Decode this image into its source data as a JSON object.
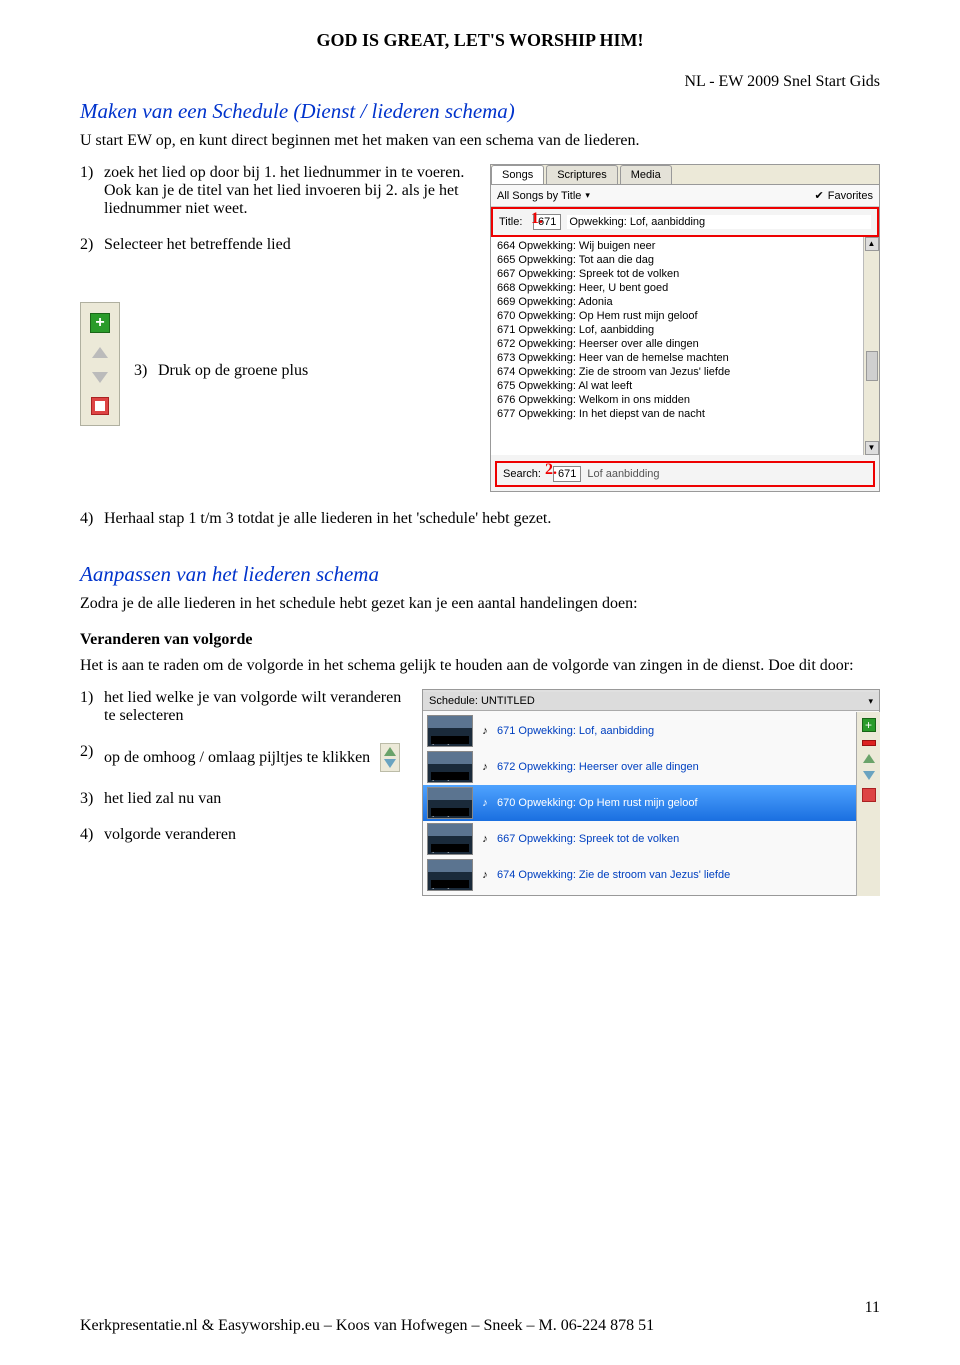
{
  "header": {
    "title": "GOD IS GREAT, LET'S WORSHIP HIM!",
    "subtitle_right": "NL - EW 2009  Snel Start Gids"
  },
  "section1": {
    "title": "Maken van een Schedule (Dienst / liederen schema)",
    "intro": "U start EW op, en kunt direct beginnen met het maken van een schema van de liederen.",
    "steps": {
      "s1_num": "1)",
      "s1": "zoek het lied op door bij 1. het liednummer in te voeren. Ook kan je de titel van het lied invoeren bij 2. als je het liednummer niet weet.",
      "s2_num": "2)",
      "s2": "Selecteer het betreffende lied",
      "s3_num": "3)",
      "s3": "Druk op de groene plus",
      "s4_num": "4)",
      "s4": "Herhaal stap 1 t/m 3 totdat je alle liederen in het 'schedule' hebt gezet."
    }
  },
  "songsPanel": {
    "tabs": {
      "t1": "Songs",
      "t2": "Scriptures",
      "t3": "Media"
    },
    "allSongs": "All Songs by Title",
    "favorites": "Favorites",
    "titleLabel": "Title:",
    "titleNum": "671",
    "titleRest": "Opwekking: Lof, aanbidding",
    "tag1": "1.",
    "list": [
      "664 Opwekking: Wij buigen neer",
      "665 Opwekking: Tot aan die dag",
      "667 Opwekking: Spreek tot de volken",
      "668 Opwekking: Heer, U bent goed",
      "669 Opwekking: Adonia",
      "670 Opwekking: Op Hem rust mijn geloof",
      "671 Opwekking: Lof, aanbidding",
      "672 Opwekking: Heerser over alle dingen",
      "673 Opwekking: Heer van de hemelse machten",
      "674 Opwekking: Zie de stroom van Jezus' liefde",
      "675 Opwekking: Al wat leeft",
      "676 Opwekking: Welkom in ons midden",
      "677 Opwekking: In het diepst van de nacht"
    ],
    "searchLabel": "Search:",
    "searchNum": "671",
    "searchRest": "Lof aanbidding",
    "tag2": "2."
  },
  "section2": {
    "title": "Aanpassen van het liederen schema",
    "intro": "Zodra je de alle liederen in het schedule hebt gezet kan je een aantal handelingen doen:",
    "subhead": "Veranderen van volgorde",
    "para": "Het is aan te raden om de volgorde in het schema gelijk te houden aan de volgorde van zingen in de dienst. Doe dit door:",
    "steps": {
      "s1_num": "1)",
      "s1": "het lied welke je van volgorde wilt veranderen te selecteren",
      "s2_num": "2)",
      "s2": "op de  omhoog / omlaag pijltjes te klikken",
      "s3_num": "3)",
      "s3": "het lied zal nu van",
      "s4_num": "4)",
      "s4": "volgorde veranderen"
    }
  },
  "schedulePanel": {
    "header": "Schedule: UNTITLED",
    "noteLabel": "<notes>",
    "autoLabel": "[auto]",
    "items": [
      {
        "title": "671 Opwekking: Lof, aanbidding"
      },
      {
        "title": "672 Opwekking: Heerser over alle dingen"
      },
      {
        "title": "670 Opwekking: Op Hem rust mijn geloof"
      },
      {
        "title": "667 Opwekking: Spreek tot de volken"
      },
      {
        "title": "674 Opwekking: Zie de stroom van Jezus' liefde"
      }
    ],
    "selectedIndex": 2
  },
  "footer": {
    "text": "Kerkpresentatie.nl & Easyworship.eu – Koos van Hofwegen – Sneek – M. 06-224 878 51",
    "page": "11"
  }
}
